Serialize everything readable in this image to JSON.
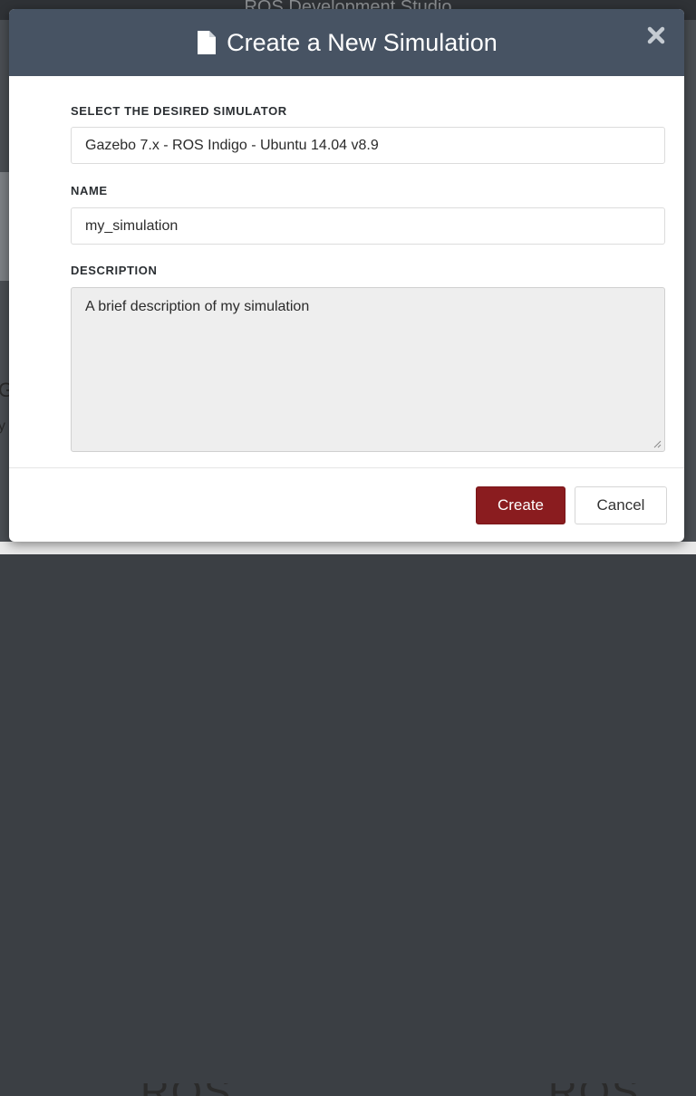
{
  "background": {
    "app_title": "ROS Development Studio",
    "logo_text_left": "ROS",
    "logo_text_right": "ROS",
    "left_glyph_1": "G",
    "left_glyph_2": "y"
  },
  "modal": {
    "title": "Create a New Simulation",
    "header_icon": "document-icon",
    "close_icon": "close-icon",
    "simulator": {
      "label": "SELECT THE DESIRED SIMULATOR",
      "value": "Gazebo 7.x - ROS Indigo - Ubuntu 14.04 v8.9"
    },
    "name": {
      "label": "NAME",
      "value": "my_simulation"
    },
    "description": {
      "label": "DESCRIPTION",
      "value": "A brief description of my simulation"
    },
    "buttons": {
      "create": "Create",
      "cancel": "Cancel"
    }
  },
  "colors": {
    "header_bg": "#475363",
    "create_button": "#8a1c1f",
    "textarea_bg": "#eeeeee"
  }
}
